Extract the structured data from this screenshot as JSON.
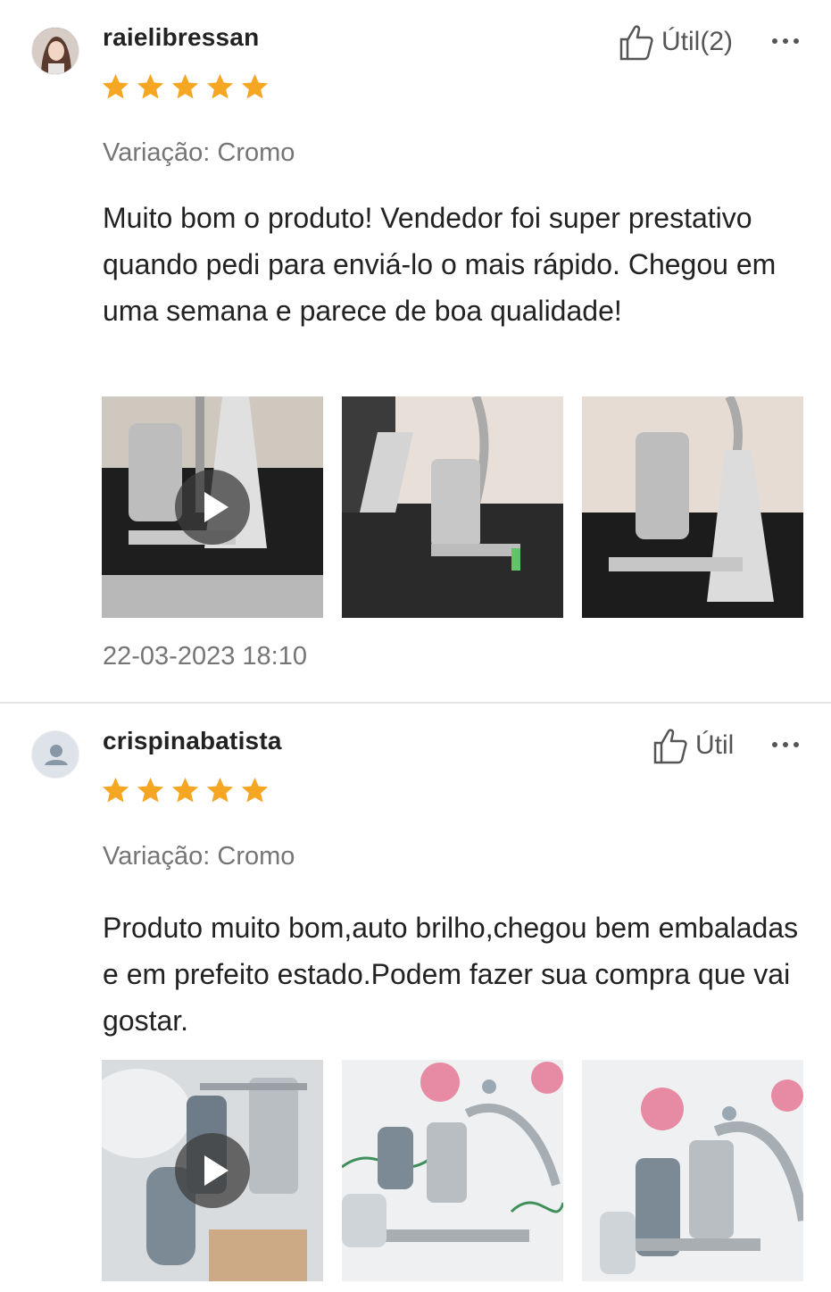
{
  "colors": {
    "star": "#F5A623",
    "muted": "#757575",
    "text": "#222222",
    "divider": "#E6E6E6"
  },
  "reviews": [
    {
      "username": "raielibressan",
      "rating": 5,
      "helpful_label": "Útil(2)",
      "variation": "Variação: Cromo",
      "text": "Muito bom o produto! Vendedor foi super prestativo quando pedi para enviá-lo o mais rápido. Chegou em uma semana e parece de boa qualidade!",
      "timestamp": "22-03-2023 18:10",
      "media": [
        {
          "kind": "video",
          "icon": "play-icon"
        },
        {
          "kind": "image"
        },
        {
          "kind": "image"
        }
      ]
    },
    {
      "username": "crispinabatista",
      "rating": 5,
      "helpful_label": "Útil",
      "variation": "Variação: Cromo",
      "text": "Produto muito bom,auto brilho,chegou bem embaladas e em prefeito estado.Podem fazer sua compra que vai gostar.",
      "media": [
        {
          "kind": "video",
          "icon": "play-icon"
        },
        {
          "kind": "image"
        },
        {
          "kind": "image"
        }
      ]
    }
  ]
}
